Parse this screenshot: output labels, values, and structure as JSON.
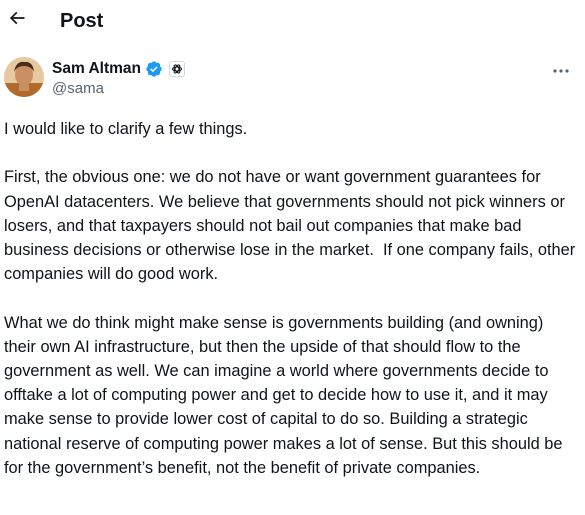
{
  "header": {
    "back_icon": "arrow-left-icon",
    "title": "Post"
  },
  "author": {
    "name": "Sam Altman",
    "handle": "@sama",
    "verified_icon": "verified-badge-icon",
    "verified_color": "#1d9bf0",
    "affiliation_icon": "openai-logo-icon"
  },
  "more_icon": "more-horizontal-icon",
  "post": {
    "paragraphs": [
      "I would like to clarify a few things.",
      "First, the obvious one: we do not have or want government guarantees for OpenAI datacenters. We believe that governments should not pick winners or losers, and that taxpayers should not bail out companies that make bad business decisions or otherwise lose in the market.  If one company fails, other companies will do good work.",
      "What we do think might make sense is governments building (and owning) their own AI infrastructure, but then the upside of that should flow to the government as well. We can imagine a world where governments decide to offtake a lot of computing power and get to decide how to use it, and it may make sense to provide lower cost of capital to do so. Building a strategic national reserve of computing power makes a lot of sense. But this should be for the government’s benefit, not the benefit of private companies."
    ]
  }
}
